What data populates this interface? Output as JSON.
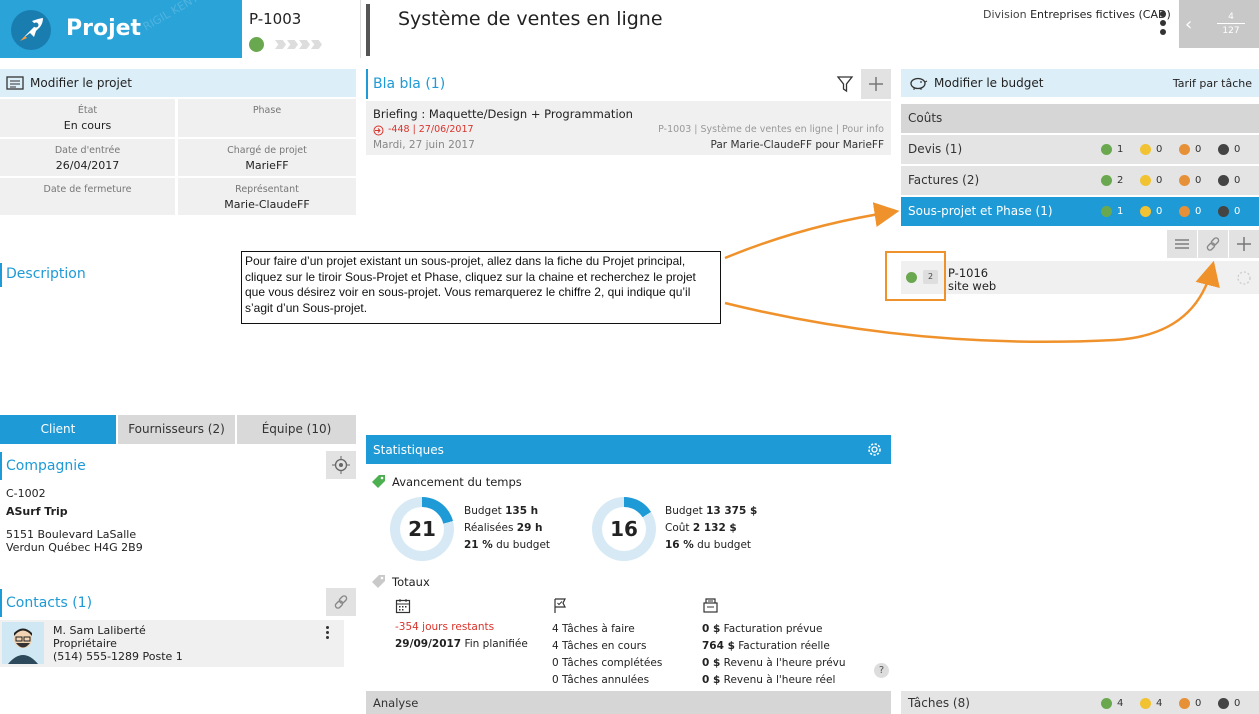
{
  "header": {
    "app_title": "Projet",
    "project_code": "P-1003",
    "page_title": "Système de ventes en ligne",
    "division_label": "Division",
    "division_value": "Entreprises fictives (CAD)",
    "pager_current": "4",
    "pager_total": "127"
  },
  "project_panel": {
    "title": "Modifier le projet",
    "fields": [
      {
        "label": "État",
        "value": "En cours"
      },
      {
        "label": "Phase",
        "value": ""
      },
      {
        "label": "Date d'entrée",
        "value": "26/04/2017"
      },
      {
        "label": "Chargé de projet",
        "value": "MarieFF"
      },
      {
        "label": "Date de fermeture",
        "value": ""
      },
      {
        "label": "Représentant",
        "value": "Marie-ClaudeFF"
      }
    ],
    "description_title": "Description"
  },
  "blabla": {
    "title": "Bla bla (1)",
    "item": {
      "title": "Briefing : Maquette/Design + Programmation",
      "overdue": "-448 | 27/06/2017",
      "context": "P-1003 | Système de ventes en ligne | Pour info",
      "date": "Mardi, 27 juin 2017",
      "author": "Par Marie-ClaudeFF pour MarieFF"
    }
  },
  "budget": {
    "title": "Modifier le budget",
    "rate": "Tarif par tâche",
    "costs_label": "Coûts",
    "rows": [
      {
        "name": "Devis (1)",
        "counts": [
          "1",
          "0",
          "0",
          "0"
        ]
      },
      {
        "name": "Factures (2)",
        "counts": [
          "2",
          "0",
          "0",
          "0"
        ]
      },
      {
        "name": "Sous-projet et Phase (1)",
        "counts": [
          "1",
          "0",
          "0",
          "0"
        ]
      }
    ],
    "subproject": {
      "badge": "2",
      "code": "P-1016",
      "name": "site web"
    },
    "tasks": {
      "name": "Tâches (8)",
      "counts": [
        "4",
        "4",
        "0",
        "0"
      ]
    },
    "colors": {
      "green": "#6aa84f",
      "yellow": "#f1c232",
      "orange": "#e69138",
      "dark": "#444444",
      "accent": "#1e9ad6"
    }
  },
  "callout": {
    "text": "Pour faire d’un projet existant un sous-projet, allez dans la fiche du Projet principal, cliquez sur le tiroir Sous-Projet et Phase, cliquez sur la chaine et recherchez le projet que vous désirez voir en sous-projet. Vous remarquerez le chiffre 2, qui indique qu’il s’agit d’un Sous-projet."
  },
  "tabs": [
    "Client",
    "Fournisseurs (2)",
    "Équipe (10)"
  ],
  "company": {
    "title": "Compagnie",
    "code": "C-1002",
    "name": "ASurf Trip",
    "address1": "5151 Boulevard LaSalle",
    "address2": "Verdun Québec  H4G 2B9"
  },
  "contacts": {
    "title": "Contacts (1)",
    "name": "M. Sam Laliberté",
    "role": "Propriétaire",
    "phone": "(514) 555-1289 Poste 1"
  },
  "stats": {
    "title": "Statistiques",
    "time_title": "Avancement du temps",
    "donut1": {
      "value": "21",
      "percent": 21,
      "line1_label": "Budget",
      "line1_value": "135 h",
      "line2_label": "Réalisées",
      "line2_value": "29 h",
      "line3_value": "21 %",
      "line3_label": "du budget"
    },
    "donut2": {
      "value": "16",
      "percent": 16,
      "line1_label": "Budget",
      "line1_value": "13 375 $",
      "line2_label": "Coût",
      "line2_value": "2 132 $",
      "line3_value": "16 %",
      "line3_label": "du budget"
    },
    "totals_title": "Totaux",
    "col1": {
      "remaining": "-354 jours restants",
      "end_date": "29/09/2017",
      "end_label": "Fin planifiée"
    },
    "col2": [
      "4 Tâches à faire",
      "4 Tâches en cours",
      "0 Tâches complétées",
      "0 Tâches annulées"
    ],
    "col3": [
      {
        "value": "0 $",
        "label": "Facturation prévue"
      },
      {
        "value": "764 $",
        "label": "Facturation réelle"
      },
      {
        "value": "0 $",
        "label": "Revenu à l'heure prévu"
      },
      {
        "value": "0 $",
        "label": "Revenu à l'heure réel"
      }
    ],
    "help": "?",
    "analyse": "Analyse"
  }
}
